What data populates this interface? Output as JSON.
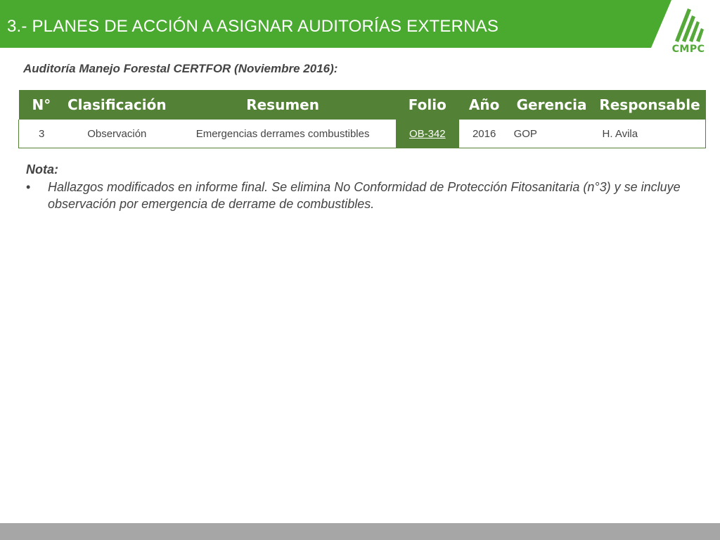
{
  "colors": {
    "brand_green": "#4aaa2f",
    "table_green": "#538135",
    "footer_gray": "#a6a6a6"
  },
  "header": {
    "title": "3.- PLANES DE ACCIÓN A  ASIGNAR AUDITORÍAS EXTERNAS"
  },
  "logo": {
    "icon": "cmpc-logo-icon",
    "text": "CMPC"
  },
  "subtitle": "Auditoría Manejo Forestal CERTFOR (Noviembre 2016):",
  "table": {
    "columns": [
      "N°",
      "Clasificación",
      "Resumen",
      "Folio",
      "Año",
      "Gerencia",
      "Responsable"
    ],
    "rows": [
      {
        "n": "3",
        "clasificacion": "Observación",
        "resumen": "Emergencias derrames combustibles",
        "folio": "OB-342",
        "anio": "2016",
        "gerencia": "GOP",
        "responsable": "H. Avila"
      }
    ]
  },
  "note": {
    "heading": "Nota:",
    "bullet_symbol": "•",
    "items": [
      "Hallazgos modificados en informe final. Se elimina No Conformidad de Protección Fitosanitaria (n°3) y se incluye observación por emergencia de derrame de combustibles."
    ]
  }
}
